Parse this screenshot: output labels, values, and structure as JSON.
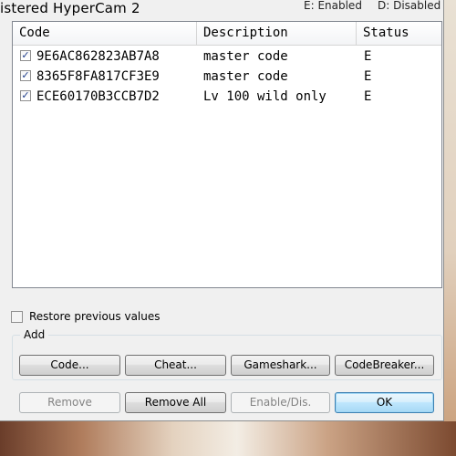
{
  "window": {
    "watermark": "istered HyperCam 2",
    "legend_enabled": "E: Enabled",
    "legend_disabled": "D: Disabled"
  },
  "code_list": {
    "columns": [
      "Code",
      "Description",
      "Status"
    ],
    "rows": [
      {
        "checked": true,
        "code": "9E6AC862823AB7A8",
        "description": "master code",
        "status": "E"
      },
      {
        "checked": true,
        "code": "8365F8FA817CF3E9",
        "description": "master code",
        "status": "E"
      },
      {
        "checked": true,
        "code": "ECE60170B3CCB7D2",
        "description": "Lv 100 wild only",
        "status": "E"
      }
    ]
  },
  "options": {
    "restore_label": "Restore previous values",
    "restore_checked": false
  },
  "add_group": {
    "title": "Add",
    "buttons": [
      "Code...",
      "Cheat...",
      "Gameshark...",
      "CodeBreaker..."
    ]
  },
  "actions": {
    "remove": "Remove",
    "remove_all": "Remove All",
    "enable_disable": "Enable/Dis.",
    "ok": "OK"
  }
}
